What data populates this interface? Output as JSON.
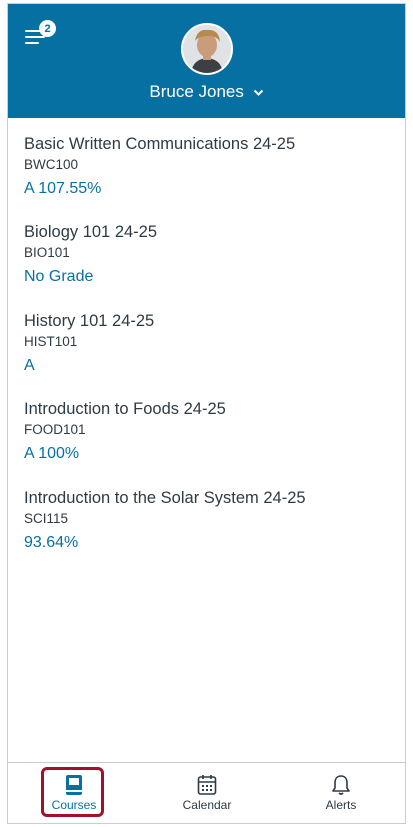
{
  "header": {
    "notification_count": "2",
    "user_name": "Bruce Jones",
    "bg_color": "#0770a3"
  },
  "courses": [
    {
      "name": "Basic Written Communications 24-25",
      "code": "BWC100",
      "grade": "A 107.55%"
    },
    {
      "name": "Biology 101 24-25",
      "code": "BIO101",
      "grade": "No Grade"
    },
    {
      "name": "History 101 24-25",
      "code": "HIST101",
      "grade": "A"
    },
    {
      "name": "Introduction to Foods 24-25",
      "code": "FOOD101",
      "grade": "A 100%"
    },
    {
      "name": "Introduction to the Solar System  24-25",
      "code": "SCI115",
      "grade": "93.64%"
    }
  ],
  "tabs": {
    "courses": "Courses",
    "calendar": "Calendar",
    "alerts": "Alerts",
    "active": "courses"
  },
  "colors": {
    "accent": "#0770a3",
    "highlight": "#a1112b"
  }
}
